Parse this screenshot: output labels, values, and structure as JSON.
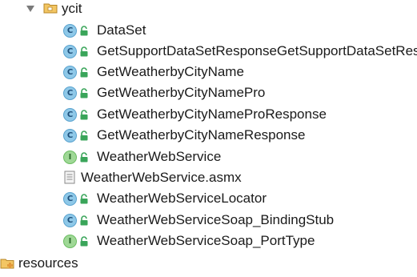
{
  "tree": {
    "package": {
      "label": "ycit",
      "icon": "package-folder-icon",
      "expanded": true
    },
    "items": [
      {
        "label": "DataSet",
        "kind": "class",
        "icon": "class-icon"
      },
      {
        "label": "GetSupportDataSetResponseGetSupportDataSetResult",
        "kind": "class",
        "icon": "class-icon"
      },
      {
        "label": "GetWeatherbyCityName",
        "kind": "class",
        "icon": "class-icon"
      },
      {
        "label": "GetWeatherbyCityNamePro",
        "kind": "class",
        "icon": "class-icon"
      },
      {
        "label": "GetWeatherbyCityNameProResponse",
        "kind": "class",
        "icon": "class-icon"
      },
      {
        "label": "GetWeatherbyCityNameResponse",
        "kind": "class",
        "icon": "class-icon"
      },
      {
        "label": "WeatherWebService",
        "kind": "interface",
        "icon": "interface-icon"
      },
      {
        "label": "WeatherWebService.asmx",
        "kind": "file",
        "icon": "file-icon"
      },
      {
        "label": "WeatherWebServiceLocator",
        "kind": "class",
        "icon": "class-icon"
      },
      {
        "label": "WeatherWebServiceSoap_BindingStub",
        "kind": "class",
        "icon": "class-icon"
      },
      {
        "label": "WeatherWebServiceSoap_PortType",
        "kind": "interface",
        "icon": "interface-icon"
      }
    ],
    "resources": {
      "label": "resources",
      "icon": "resources-folder-icon"
    },
    "badges": {
      "class": "C",
      "interface": "I"
    },
    "colors": {
      "class_fill": "#8ec8e8",
      "interface_fill": "#9fd896",
      "lock": "#3aa55a",
      "folder": "#e8b04a"
    }
  }
}
